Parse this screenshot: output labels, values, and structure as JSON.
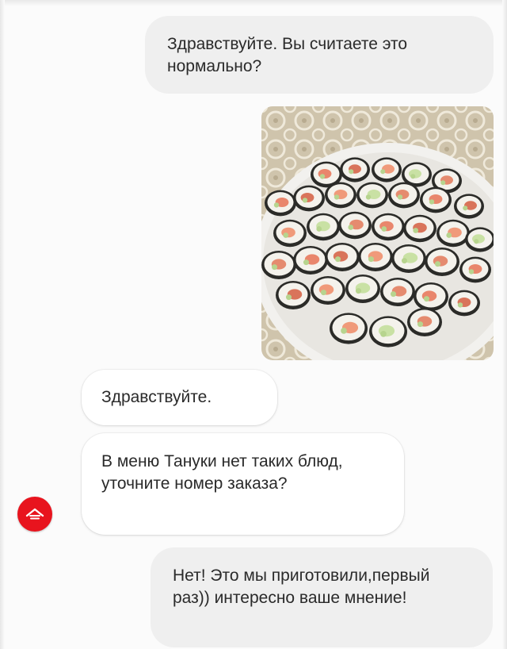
{
  "chat": {
    "messages": [
      {
        "direction": "outgoing",
        "text": "Здравствуйте. Вы считаете это нормально?"
      },
      {
        "direction": "outgoing",
        "type": "image",
        "image_description": "plate-of-homemade-sushi-rolls"
      },
      {
        "direction": "incoming",
        "text": "Здравствуйте."
      },
      {
        "direction": "incoming",
        "text": "В меню Тануки нет таких блюд, уточните номер заказа?"
      },
      {
        "direction": "outgoing",
        "text": "Нет! Это мы приготовили,первый раз)) интересно ваше мнение!"
      }
    ],
    "support_avatar": {
      "icon": "restaurant-logo-icon",
      "color": "#e8141e"
    }
  },
  "colors": {
    "outgoing_bubble": "#efefef",
    "incoming_bubble": "#ffffff",
    "text": "#2a2a2a",
    "brand": "#e8141e"
  }
}
